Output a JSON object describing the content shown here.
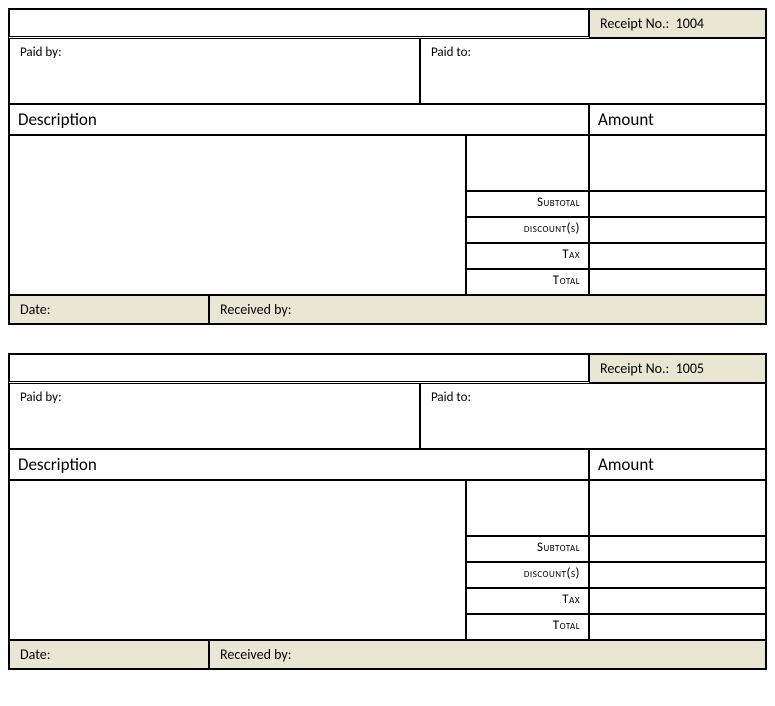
{
  "labels": {
    "receipt_no": "Receipt No.:",
    "paid_by": "Paid by:",
    "paid_to": "Paid to:",
    "description": "Description",
    "amount": "Amount",
    "subtotal": "Subtotal",
    "discounts": "discount(s)",
    "tax": "Tax",
    "total": "Total",
    "date": "Date:",
    "received_by": "Received by:"
  },
  "receipts": [
    {
      "number": "1004"
    },
    {
      "number": "1005"
    }
  ]
}
